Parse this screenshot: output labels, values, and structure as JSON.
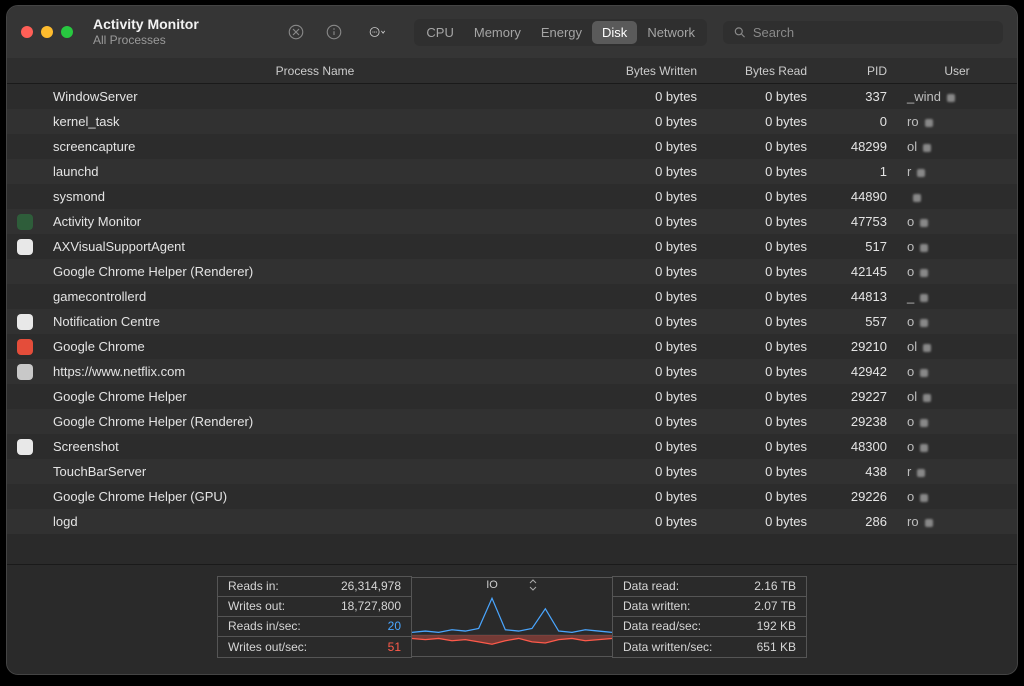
{
  "window": {
    "title": "Activity Monitor",
    "subtitle": "All Processes"
  },
  "tabs": [
    {
      "label": "CPU"
    },
    {
      "label": "Memory"
    },
    {
      "label": "Energy"
    },
    {
      "label": "Disk"
    },
    {
      "label": "Network"
    }
  ],
  "active_tab_index": 3,
  "search": {
    "placeholder": "Search"
  },
  "columns": {
    "name": "Process Name",
    "written": "Bytes Written",
    "read": "Bytes Read",
    "pid": "PID",
    "user": "User"
  },
  "processes": [
    {
      "icon": null,
      "name": "WindowServer",
      "written": "0 bytes",
      "read": "0 bytes",
      "pid": "337",
      "user": "_wind"
    },
    {
      "icon": null,
      "name": "kernel_task",
      "written": "0 bytes",
      "read": "0 bytes",
      "pid": "0",
      "user": "ro"
    },
    {
      "icon": null,
      "name": "screencapture",
      "written": "0 bytes",
      "read": "0 bytes",
      "pid": "48299",
      "user": "ol"
    },
    {
      "icon": null,
      "name": "launchd",
      "written": "0 bytes",
      "read": "0 bytes",
      "pid": "1",
      "user": "r"
    },
    {
      "icon": null,
      "name": "sysmond",
      "written": "0 bytes",
      "read": "0 bytes",
      "pid": "44890",
      "user": ""
    },
    {
      "icon": "#2e5d3a",
      "name": "Activity Monitor",
      "written": "0 bytes",
      "read": "0 bytes",
      "pid": "47753",
      "user": "o"
    },
    {
      "icon": "#e8e8e8",
      "name": "AXVisualSupportAgent",
      "written": "0 bytes",
      "read": "0 bytes",
      "pid": "517",
      "user": "o"
    },
    {
      "icon": null,
      "name": "Google Chrome Helper (Renderer)",
      "written": "0 bytes",
      "read": "0 bytes",
      "pid": "42145",
      "user": "o"
    },
    {
      "icon": null,
      "name": "gamecontrollerd",
      "written": "0 bytes",
      "read": "0 bytes",
      "pid": "44813",
      "user": "_"
    },
    {
      "icon": "#e8e8e8",
      "name": "Notification Centre",
      "written": "0 bytes",
      "read": "0 bytes",
      "pid": "557",
      "user": "o"
    },
    {
      "icon": "#e44d3a",
      "name": "Google Chrome",
      "written": "0 bytes",
      "read": "0 bytes",
      "pid": "29210",
      "user": "ol"
    },
    {
      "icon": "#c8c8c8",
      "name": "https://www.netflix.com",
      "written": "0 bytes",
      "read": "0 bytes",
      "pid": "42942",
      "user": "o"
    },
    {
      "icon": null,
      "name": "Google Chrome Helper",
      "written": "0 bytes",
      "read": "0 bytes",
      "pid": "29227",
      "user": "ol"
    },
    {
      "icon": null,
      "name": "Google Chrome Helper (Renderer)",
      "written": "0 bytes",
      "read": "0 bytes",
      "pid": "29238",
      "user": "o"
    },
    {
      "icon": "#e8e8e8",
      "name": "Screenshot",
      "written": "0 bytes",
      "read": "0 bytes",
      "pid": "48300",
      "user": "o"
    },
    {
      "icon": null,
      "name": "TouchBarServer",
      "written": "0 bytes",
      "read": "0 bytes",
      "pid": "438",
      "user": "r"
    },
    {
      "icon": null,
      "name": "Google Chrome Helper (GPU)",
      "written": "0 bytes",
      "read": "0 bytes",
      "pid": "29226",
      "user": "o"
    },
    {
      "icon": null,
      "name": "logd",
      "written": "0 bytes",
      "read": "0 bytes",
      "pid": "286",
      "user": "ro"
    }
  ],
  "footer": {
    "left": {
      "reads_in_label": "Reads in:",
      "reads_in": "26,314,978",
      "writes_out_label": "Writes out:",
      "writes_out": "18,727,800",
      "reads_sec_label": "Reads in/sec:",
      "reads_sec": "20",
      "writes_sec_label": "Writes out/sec:",
      "writes_sec": "51"
    },
    "mid": {
      "label": "IO"
    },
    "right": {
      "data_read_label": "Data read:",
      "data_read": "2.16 TB",
      "data_written_label": "Data written:",
      "data_written": "2.07 TB",
      "data_read_sec_label": "Data read/sec:",
      "data_read_sec": "192 KB",
      "data_written_sec_label": "Data written/sec:",
      "data_written_sec": "651 KB"
    }
  },
  "chart_data": {
    "type": "line",
    "title": "IO",
    "series": [
      {
        "name": "Reads in/sec",
        "color": "#4aa6ff",
        "values": [
          2,
          3,
          2,
          4,
          3,
          5,
          28,
          4,
          3,
          5,
          20,
          3,
          2,
          4,
          3,
          2
        ]
      },
      {
        "name": "Writes out/sec",
        "color": "#ff5a4a",
        "values": [
          3,
          4,
          3,
          5,
          4,
          6,
          8,
          5,
          3,
          6,
          7,
          4,
          3,
          5,
          4,
          3
        ]
      }
    ]
  }
}
